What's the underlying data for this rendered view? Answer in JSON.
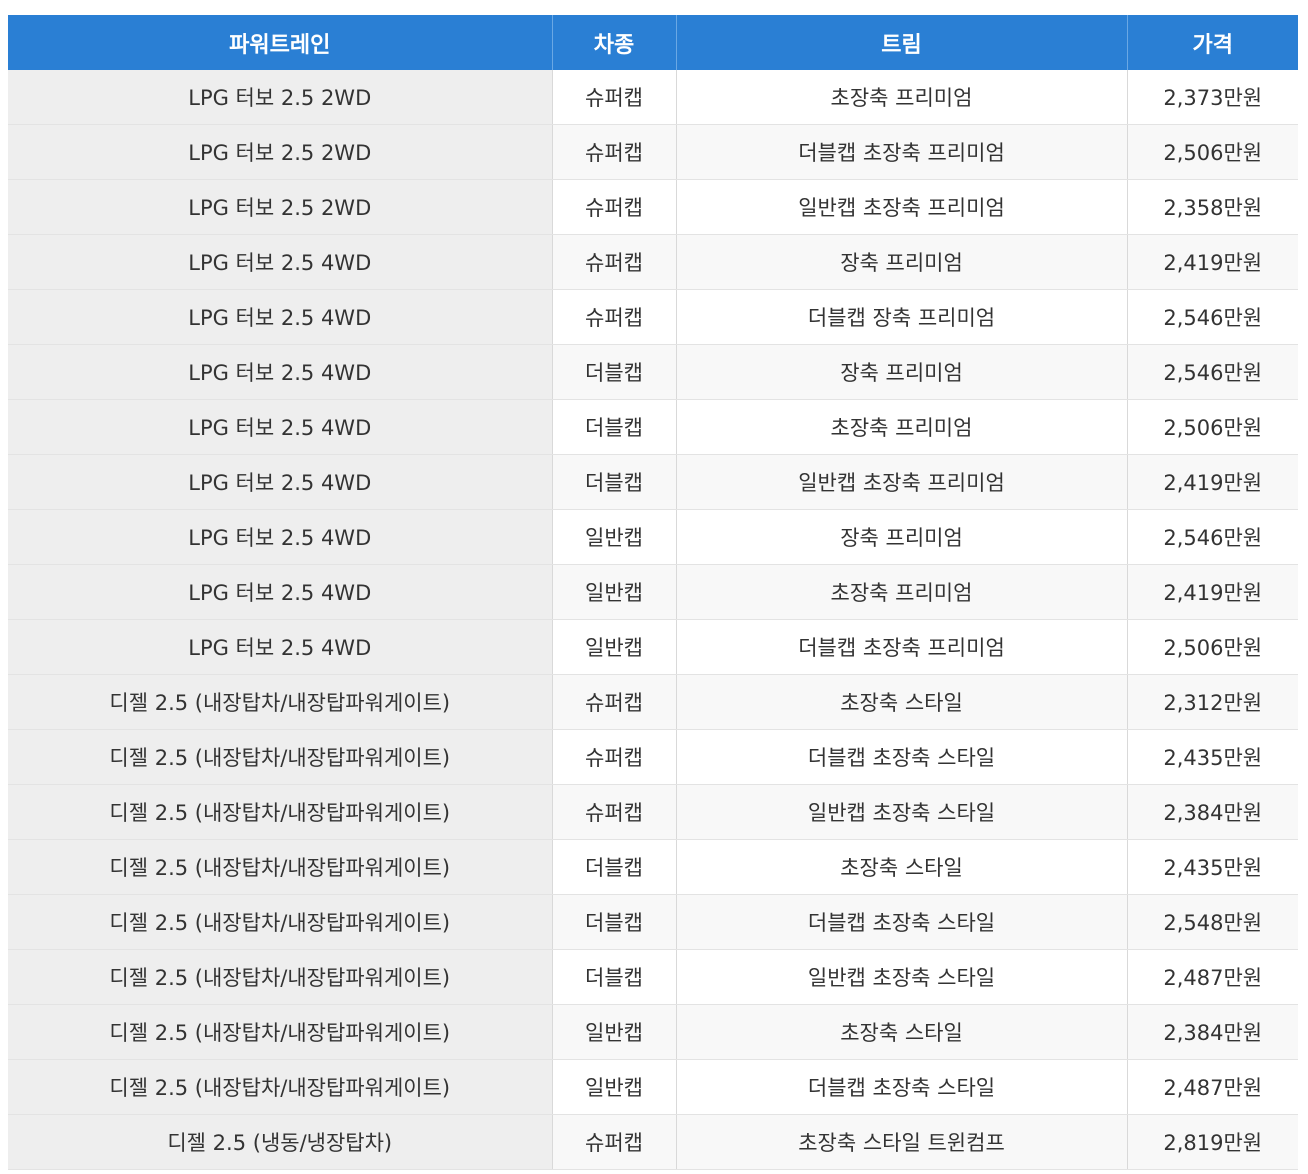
{
  "table": {
    "headers": [
      "파워트레인",
      "차종",
      "트림",
      "가격"
    ],
    "rows": [
      [
        "LPG 터보 2.5 2WD",
        "슈퍼캡",
        "초장축 프리미엄",
        "2,373만원"
      ],
      [
        "LPG 터보 2.5 2WD",
        "슈퍼캡",
        "더블캡 초장축 프리미엄",
        "2,506만원"
      ],
      [
        "LPG 터보 2.5 2WD",
        "슈퍼캡",
        "일반캡 초장축 프리미엄",
        "2,358만원"
      ],
      [
        "LPG 터보 2.5 4WD",
        "슈퍼캡",
        "장축 프리미엄",
        "2,419만원"
      ],
      [
        "LPG 터보 2.5 4WD",
        "슈퍼캡",
        "더블캡 장축 프리미엄",
        "2,546만원"
      ],
      [
        "LPG 터보 2.5 4WD",
        "더블캡",
        "장축 프리미엄",
        "2,546만원"
      ],
      [
        "LPG 터보 2.5 4WD",
        "더블캡",
        "초장축 프리미엄",
        "2,506만원"
      ],
      [
        "LPG 터보 2.5 4WD",
        "더블캡",
        "일반캡 초장축 프리미엄",
        "2,419만원"
      ],
      [
        "LPG 터보 2.5 4WD",
        "일반캡",
        "장축 프리미엄",
        "2,546만원"
      ],
      [
        "LPG 터보 2.5 4WD",
        "일반캡",
        "초장축 프리미엄",
        "2,419만원"
      ],
      [
        "LPG 터보 2.5 4WD",
        "일반캡",
        "더블캡 초장축 프리미엄",
        "2,506만원"
      ],
      [
        "디젤 2.5 (내장탑차/내장탑파워게이트)",
        "슈퍼캡",
        "초장축 스타일",
        "2,312만원"
      ],
      [
        "디젤 2.5 (내장탑차/내장탑파워게이트)",
        "슈퍼캡",
        "더블캡 초장축 스타일",
        "2,435만원"
      ],
      [
        "디젤 2.5 (내장탑차/내장탑파워게이트)",
        "슈퍼캡",
        "일반캡 초장축 스타일",
        "2,384만원"
      ],
      [
        "디젤 2.5 (내장탑차/내장탑파워게이트)",
        "더블캡",
        "초장축 스타일",
        "2,435만원"
      ],
      [
        "디젤 2.5 (내장탑차/내장탑파워게이트)",
        "더블캡",
        "더블캡 초장축 스타일",
        "2,548만원"
      ],
      [
        "디젤 2.5 (내장탑차/내장탑파워게이트)",
        "더블캡",
        "일반캡 초장축 스타일",
        "2,487만원"
      ],
      [
        "디젤 2.5 (내장탑차/내장탑파워게이트)",
        "일반캡",
        "초장축 스타일",
        "2,384만원"
      ],
      [
        "디젤 2.5 (내장탑차/내장탑파워게이트)",
        "일반캡",
        "더블캡 초장축 스타일",
        "2,487만원"
      ],
      [
        "디젤 2.5 (냉동/냉장탑차)",
        "슈퍼캡",
        "초장축 스타일 트윈컴프",
        "2,819만원"
      ]
    ]
  },
  "colors": {
    "header_bg": "#2a7fd4",
    "header_text": "#ffffff",
    "first_col_bg": "#eeeeee",
    "alt_row_bg": "#f8f8f8",
    "text": "#333333"
  }
}
